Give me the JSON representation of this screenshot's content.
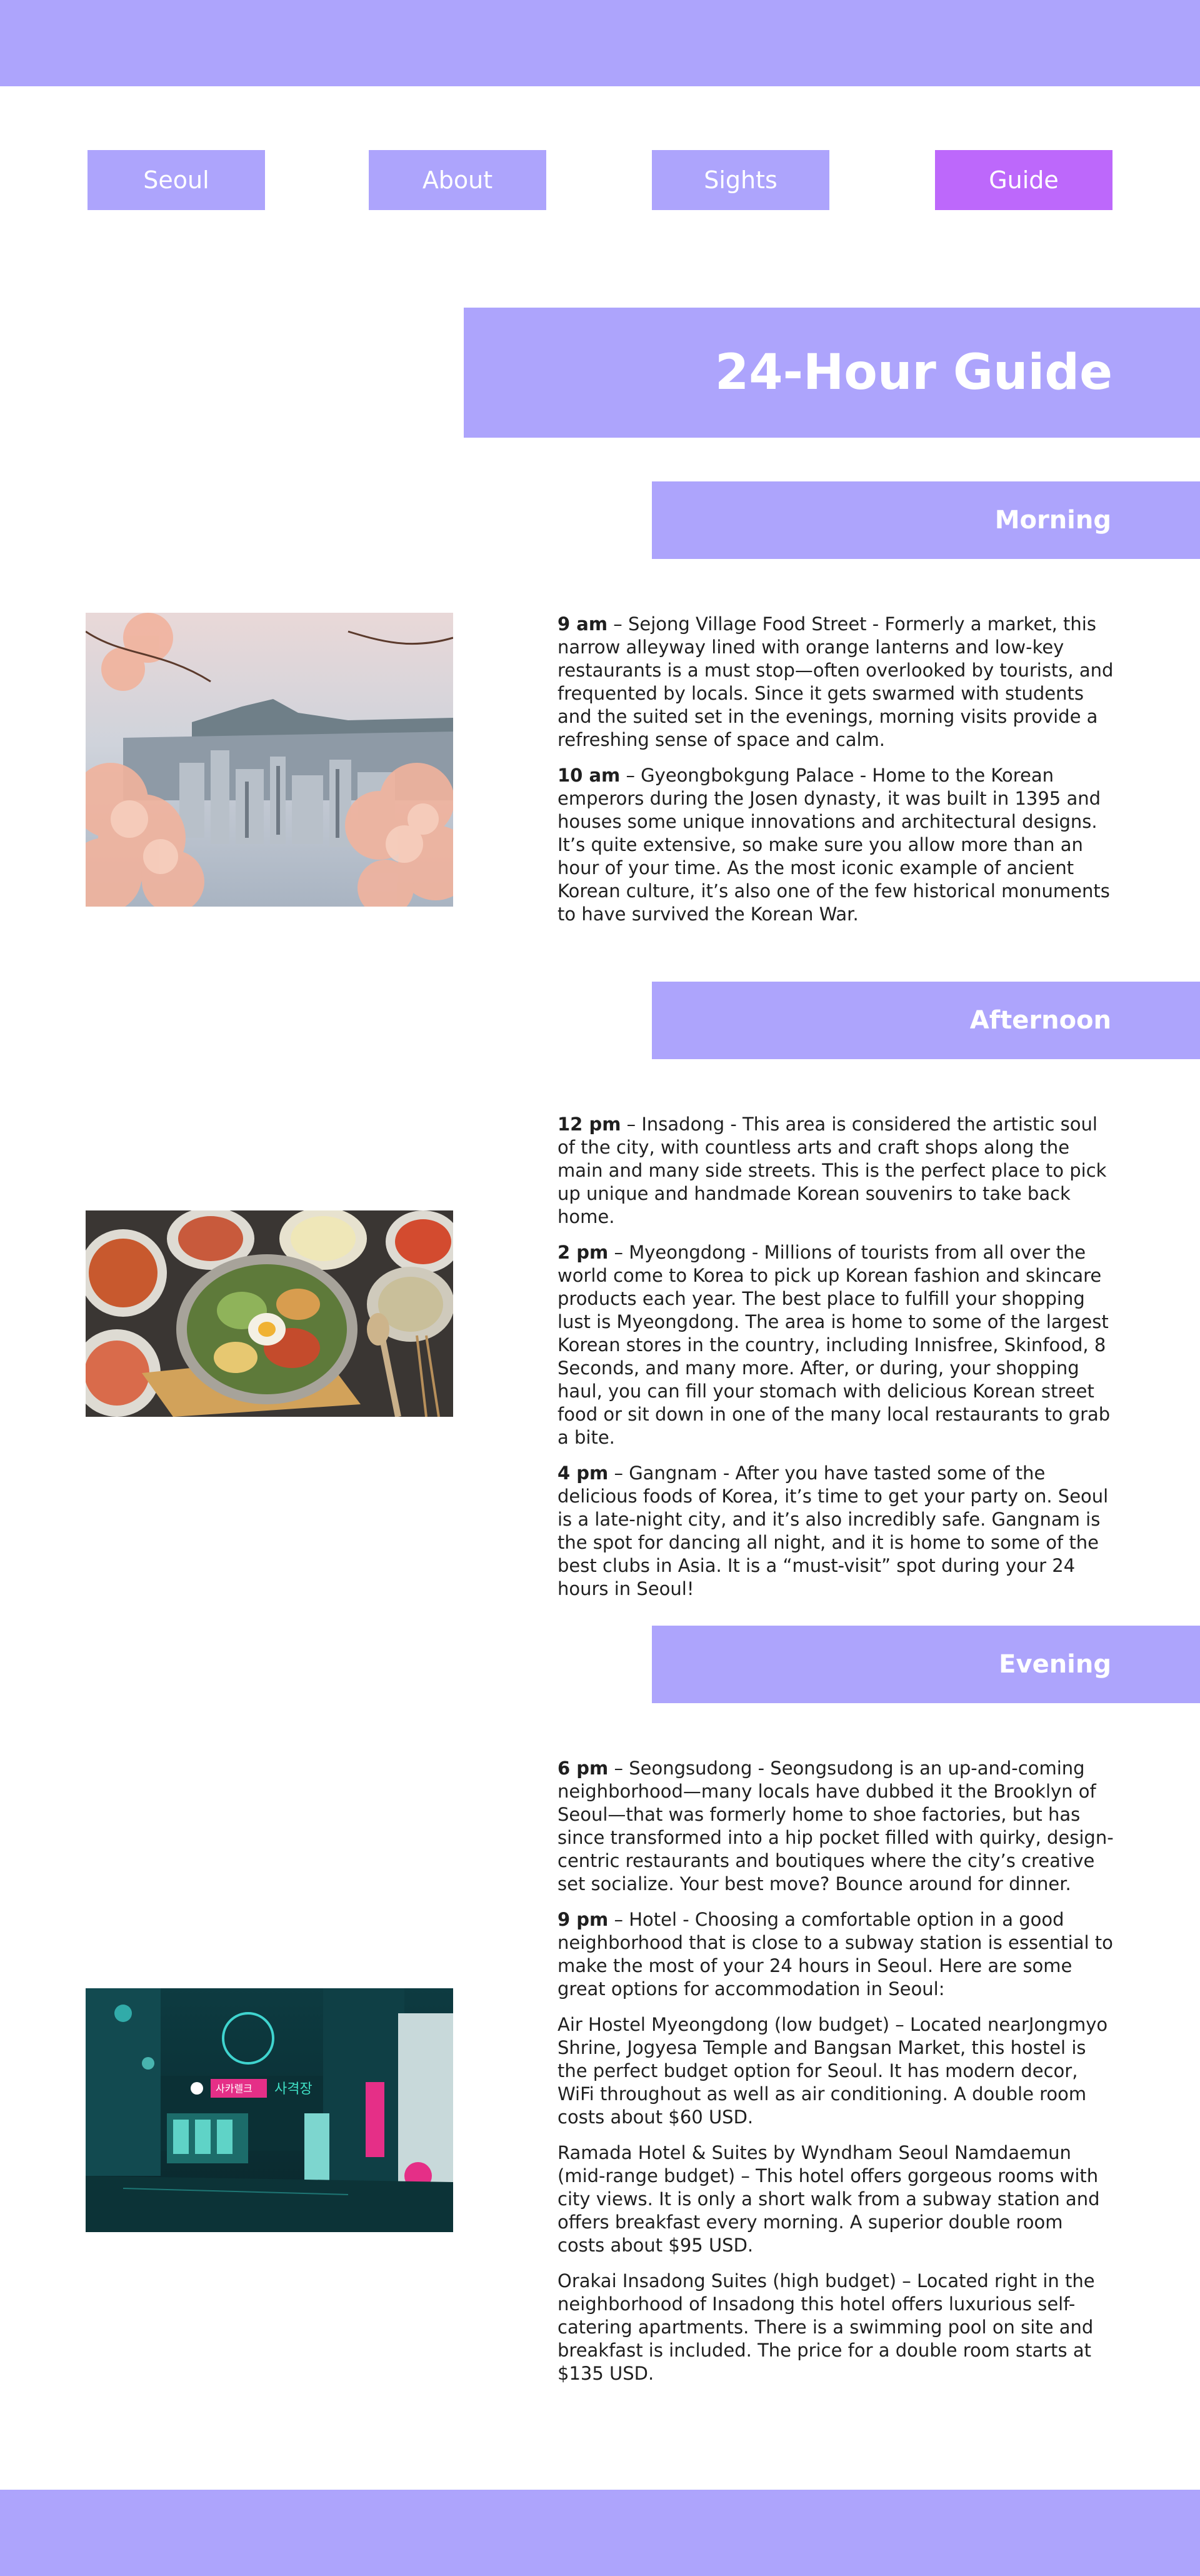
{
  "nav": [
    {
      "label": "Seoul"
    },
    {
      "label": "About"
    },
    {
      "label": "Sights"
    },
    {
      "label": "Guide",
      "active": true
    }
  ],
  "page_title": "24-Hour Guide",
  "colors": {
    "accent": "#ada4fc",
    "active": "#bd68fb",
    "text": "#1f1f1f"
  },
  "sections": {
    "morning": {
      "heading": "Morning",
      "image": "seoul-cherry-blossom-skyline-photo",
      "items": [
        {
          "time": "9 am",
          "text": " – Sejong Village Food Street - Formerly a market, this narrow alleyway lined with orange lanterns and low-key restaurants is a must stop—often overlooked by tourists, and frequented by locals. Since it gets swarmed with students and the suited set in the evenings, morning visits provide a refreshing sense of space and calm."
        },
        {
          "time": "10 am",
          "text": " – Gyeongbokgung Palace - Home to the Korean emperors during the Josen dynasty, it was built in 1395 and houses some unique innovations and architectural designs. It’s quite extensive, so make sure you allow more than an hour of your time. As the most iconic example of ancient Korean culture, it’s also one of the few historical monuments to have survived the Korean War."
        }
      ]
    },
    "afternoon": {
      "heading": "Afternoon",
      "image": "bibimbap-korean-food-photo",
      "items": [
        {
          "time": "12 pm",
          "text": " – Insadong - This area is considered the artistic soul of the city, with countless arts and craft shops along the main and many side streets. This is the perfect place to pick up unique and handmade Korean souvenirs to take back home."
        },
        {
          "time": "2 pm",
          "text": " – Myeongdong - Millions of tourists from all over the world come to Korea to pick up Korean fashion and skincare products each year. The best place to fulfill your shopping lust is Myeongdong. The area is home to some of the largest Korean stores in the country, including Innisfree, Skinfood, 8 Seconds, and many more. After, or during, your shopping haul, you can fill your stomach with delicious Korean street food or sit down in one of the many local restaurants to grab a bite."
        },
        {
          "time": "4 pm",
          "text": " – Gangnam - After you have tasted some of the delicious foods of Korea, it’s time to get your party on. Seoul is a late-night city, and it’s also incredibly safe. Gangnam is the spot for dancing all night, and it is home to some of the best clubs in Asia. It is a “must-visit” spot during your 24 hours in Seoul!"
        }
      ]
    },
    "evening": {
      "heading": "Evening",
      "image": "seoul-night-street-neon-photo",
      "items": [
        {
          "time": "6 pm",
          "text": " – Seongsudong - Seongsudong is an up-and-coming neighborhood—many locals have dubbed it the Brooklyn of Seoul—that was formerly home to shoe factories, but has since transformed into a hip pocket filled with quirky, design-centric restaurants and boutiques where the city’s creative set socialize. Your best move? Bounce around for dinner."
        },
        {
          "time": "9 pm",
          "text": " – Hotel - Choosing a comfortable option in a good neighborhood that is close to a subway station is essential to make the most of your 24 hours in Seoul. Here are some great options for accommodation in Seoul:"
        }
      ],
      "hotels": [
        "Air Hostel Myeongdong (low budget) – Located nearJongmyo Shrine, Jogyesa Temple and Bangsan Market, this hostel is the perfect budget option for Seoul. It has modern decor, WiFi throughout as well as air conditioning. A double room costs about $60 USD.",
        "Ramada Hotel & Suites by Wyndham Seoul Namdaemun (mid-range budget) – This hotel offers gorgeous rooms with city views. It is only a short walk from a subway station and offers breakfast every morning. A superior double room costs about $95 USD.",
        "Orakai Insadong Suites (high budget) – Located right in the neighborhood of Insadong this hotel offers luxurious self-catering apartments. There is a swimming pool on site and breakfast is included. The price for a double room starts at $135 USD."
      ],
      "neon_signs": [
        "사카렐크",
        "사격장"
      ]
    }
  }
}
